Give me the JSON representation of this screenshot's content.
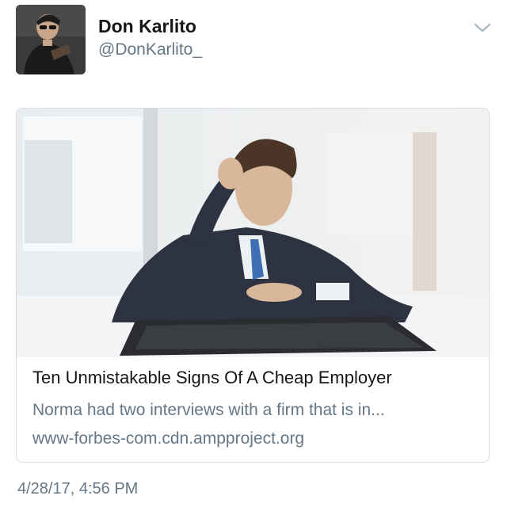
{
  "user": {
    "display_name": "Don Karlito",
    "handle": "@DonKarlito_"
  },
  "card": {
    "title": "Ten Unmistakable Signs Of A Cheap Employer",
    "description": "Norma had two interviews with a firm that is in...",
    "domain": "www-forbes-com.cdn.ampproject.org"
  },
  "tweet": {
    "timestamp": "4/28/17, 4:56 PM"
  },
  "icons": {
    "menu": "chevron-down-icon"
  },
  "colors": {
    "text": "#14171a",
    "secondary_text": "#657786",
    "card_border": "#d7dde2"
  }
}
